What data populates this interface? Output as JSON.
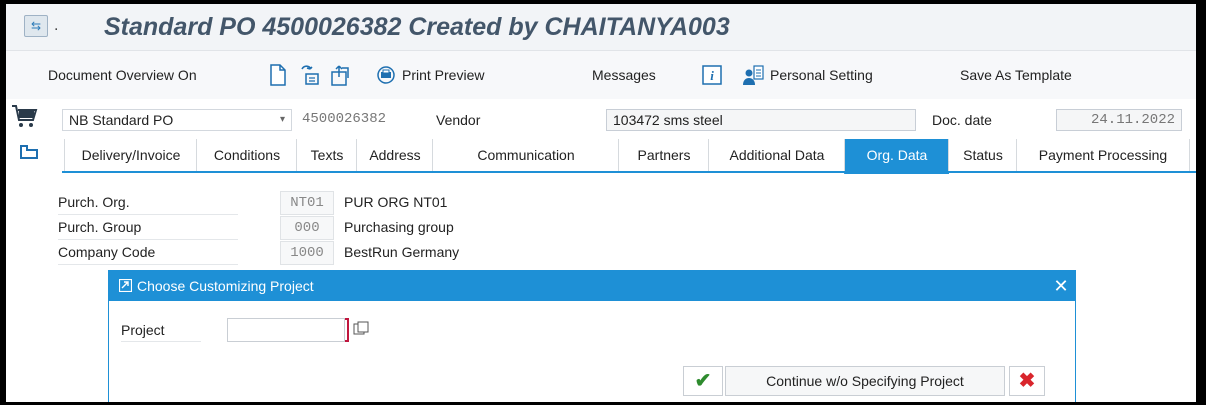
{
  "window": {
    "title": "Standard PO 4500026382 Created by CHAITANYA003"
  },
  "toolbar": {
    "document_overview": "Document Overview On",
    "print_preview": "Print Preview",
    "messages": "Messages",
    "personal_setting": "Personal Setting",
    "save_template": "Save As Template",
    "icons": [
      "new-document-icon",
      "hold-icon",
      "other-document-icon",
      "print-preview-icon",
      "info-icon",
      "personal-setting-icon"
    ]
  },
  "header": {
    "doc_type": "NB Standard PO",
    "po_number": "4500026382",
    "vendor_label": "Vendor",
    "vendor_value": "103472 sms steel",
    "doc_date_label": "Doc. date",
    "doc_date_value": "24.11.2022"
  },
  "tabs": [
    {
      "label": "Delivery/Invoice"
    },
    {
      "label": "Conditions"
    },
    {
      "label": "Texts"
    },
    {
      "label": "Address"
    },
    {
      "label": "Communication"
    },
    {
      "label": "Partners"
    },
    {
      "label": "Additional Data"
    },
    {
      "label": "Org. Data",
      "active": true
    },
    {
      "label": "Status"
    },
    {
      "label": "Payment Processing"
    }
  ],
  "org_data": [
    {
      "label": "Purch. Org.",
      "code": "NT01",
      "desc": "PUR ORG NT01"
    },
    {
      "label": "Purch. Group",
      "code": "000",
      "desc": "Purchasing group"
    },
    {
      "label": "Company Code",
      "code": "1000",
      "desc": "BestRun Germany"
    }
  ],
  "dialog": {
    "title": "Choose Customizing Project",
    "project_label": "Project",
    "project_value": "",
    "continue_label": "Continue w/o Specifying Project",
    "close_symbol": "✕",
    "confirm_symbol": "✔",
    "cancel_symbol": "✖"
  },
  "colors": {
    "accent": "#1e90d6",
    "title_text": "#43566a",
    "confirm": "#2e8b2e",
    "cancel": "#d9252c"
  }
}
